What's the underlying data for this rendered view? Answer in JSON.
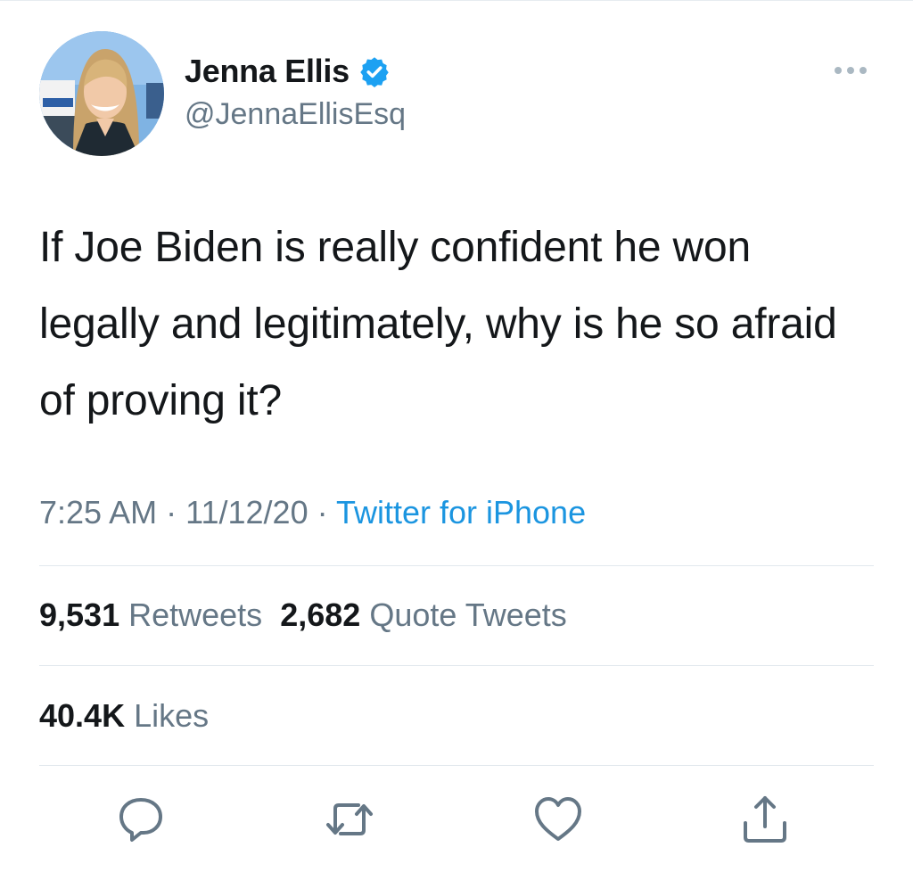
{
  "author": {
    "display_name": "Jenna Ellis",
    "handle": "@JennaEllisEsq",
    "verified_icon": "verified-badge-icon",
    "avatar_icon": "profile-photo"
  },
  "more_icon": "more-options-icon",
  "tweet": {
    "text": "If Joe Biden is really confident he won legally and legitimately, why is he so afraid of proving it?"
  },
  "meta": {
    "time": "7:25 AM",
    "separator": "·",
    "date": "11/12/20",
    "source": "Twitter for iPhone"
  },
  "stats": {
    "retweets_count": "9,531",
    "retweets_label": "Retweets",
    "quotes_count": "2,682",
    "quotes_label": "Quote Tweets",
    "likes_count": "40.4K",
    "likes_label": "Likes"
  },
  "actions": [
    {
      "icon": "reply-icon"
    },
    {
      "icon": "retweet-icon"
    },
    {
      "icon": "like-icon"
    },
    {
      "icon": "share-icon"
    }
  ],
  "colors": {
    "text": "#14171a",
    "secondary": "#657786",
    "link": "#1b95e0",
    "verified": "#1da1f2",
    "divider": "#e1e8ed"
  }
}
